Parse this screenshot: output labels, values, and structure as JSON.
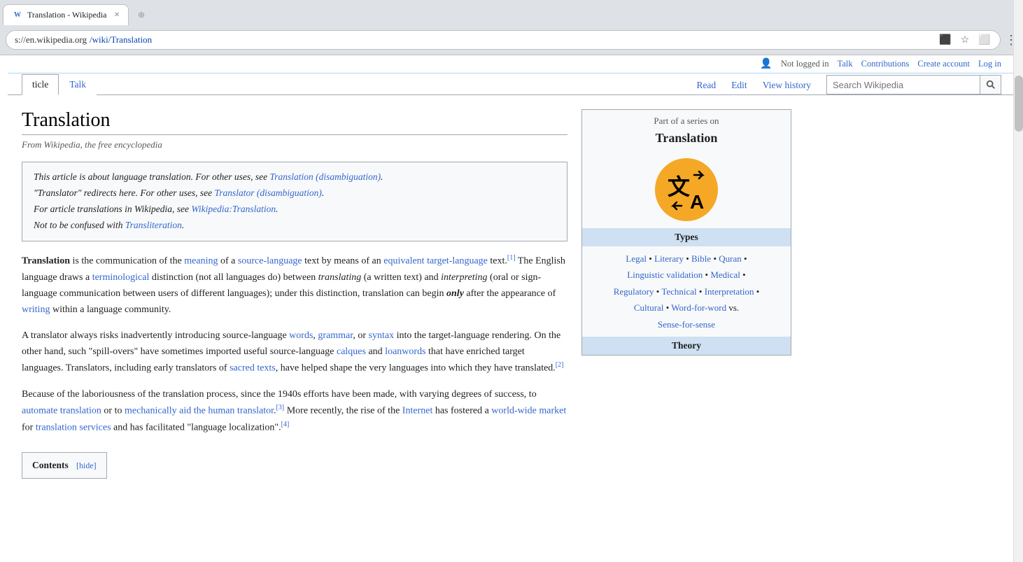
{
  "browser": {
    "tab_active_label": "Translation - Wikipedia",
    "tab_favicon": "W",
    "tab_close": "×",
    "address_scheme": "s://en.wikipedia.org",
    "address_path": "/wiki/Translation",
    "address_full": "s://en.wikipedia.org/wiki/Translation"
  },
  "userbar": {
    "not_logged": "Not logged in",
    "talk": "Talk",
    "contributions": "Contributions",
    "create_account": "Create account",
    "log_in": "Log in"
  },
  "nav": {
    "article": "ticle",
    "talk": "Talk",
    "read": "Read",
    "edit": "Edit",
    "view_history": "View history",
    "search_placeholder": "Search Wikipedia"
  },
  "page": {
    "title": "Translation",
    "from_wiki": "From Wikipedia, the free encyclopedia"
  },
  "hatnote": {
    "line1_before": "This article is about language translation. For other uses, see ",
    "line1_link": "Translation (disambiguation)",
    "line1_after": ".",
    "line2_before": "\"Translator\" redirects here. For other uses, see ",
    "line2_link": "Translator (disambiguation)",
    "line2_after": ".",
    "line3_before": "For article translations in Wikipedia, see ",
    "line3_link": "Wikipedia:Translation",
    "line3_after": ".",
    "line4_before": "Not to be confused with ",
    "line4_link": "Transliteration",
    "line4_after": "."
  },
  "article": {
    "p1_before": " is the communication of the ",
    "p1_link1": "meaning",
    "p1_middle1": " of a ",
    "p1_link2": "source-language",
    "p1_middle2": " text by means of an ",
    "p1_link3": "equivalent target-language",
    "p1_after1": " text.",
    "p1_sup": "[1]",
    "p1_continue": " The English language draws a ",
    "p1_link4": "terminological",
    "p1_middle3": " distinction (not all languages do) between ",
    "p1_italic1": "translating",
    "p1_middle4": " (a written text) and ",
    "p1_italic2": "interpreting",
    "p1_end": " (oral or sign-language communication between users of different languages); under this distinction, translation can begin ",
    "p1_only": "only",
    "p1_final": " after the appearance of ",
    "p1_link5": "writing",
    "p1_last": " within a language community.",
    "p2": "A translator always risks inadvertently introducing source-language ",
    "p2_link1": "words",
    "p2_comma1": ", ",
    "p2_link2": "grammar",
    "p2_comma2": ", or ",
    "p2_link3": "syntax",
    "p2_mid": " into the target-language rendering. On the other hand, such \"spill-overs\" have sometimes imported useful source-language ",
    "p2_link4": "calques",
    "p2_and": " and ",
    "p2_link5": "loanwords",
    "p2_end": " that have enriched target languages. Translators, including early translators of ",
    "p2_link6": "sacred texts",
    "p2_final": ", have helped shape the very languages into which they have translated.",
    "p2_sup": "[2]",
    "p3_before": "Because of the laboriousness of the translation process, since the 1940s efforts have been made, with varying degrees of success, to ",
    "p3_link1": "automate translation",
    "p3_or": " or to ",
    "p3_link2": "mechanically aid the human translator",
    "p3_sup": "[3]",
    "p3_mid": " More recently, the rise of the ",
    "p3_link3": "Internet",
    "p3_mid2": " has fostered a ",
    "p3_link4": "world-wide market",
    "p3_mid3": " for ",
    "p3_link5": "translation services",
    "p3_end": " and has facilitated \"language localization\".",
    "p3_sup2": "[4]",
    "contents_title": "Contents"
  },
  "infobox": {
    "part_series": "Part of a series on",
    "title": "Translation",
    "icon_symbol": "文A",
    "types_header": "Types",
    "types": [
      {
        "text": "Legal",
        "link": true
      },
      {
        "text": " • ",
        "link": false
      },
      {
        "text": "Literary",
        "link": true
      },
      {
        "text": " • ",
        "link": false
      },
      {
        "text": "Bible",
        "link": true
      },
      {
        "text": " • ",
        "link": false
      },
      {
        "text": "Quran",
        "link": true
      },
      {
        "text": " • ",
        "link": false
      },
      {
        "text": "Linguistic validation",
        "link": true
      },
      {
        "text": " • ",
        "link": false
      },
      {
        "text": "Medical",
        "link": true
      },
      {
        "text": " • ",
        "link": false
      },
      {
        "text": "Regulatory",
        "link": true
      },
      {
        "text": " • ",
        "link": false
      },
      {
        "text": "Technical",
        "link": true
      },
      {
        "text": " • ",
        "link": false
      },
      {
        "text": "Interpretation",
        "link": true
      },
      {
        "text": " • ",
        "link": false
      },
      {
        "text": "Cultural",
        "link": true
      },
      {
        "text": " • ",
        "link": false
      },
      {
        "text": "Word-for-word",
        "link": true
      },
      {
        "text": " vs. ",
        "link": false
      },
      {
        "text": "Sense-for-sense",
        "link": true
      }
    ],
    "theory_header": "Theory"
  }
}
